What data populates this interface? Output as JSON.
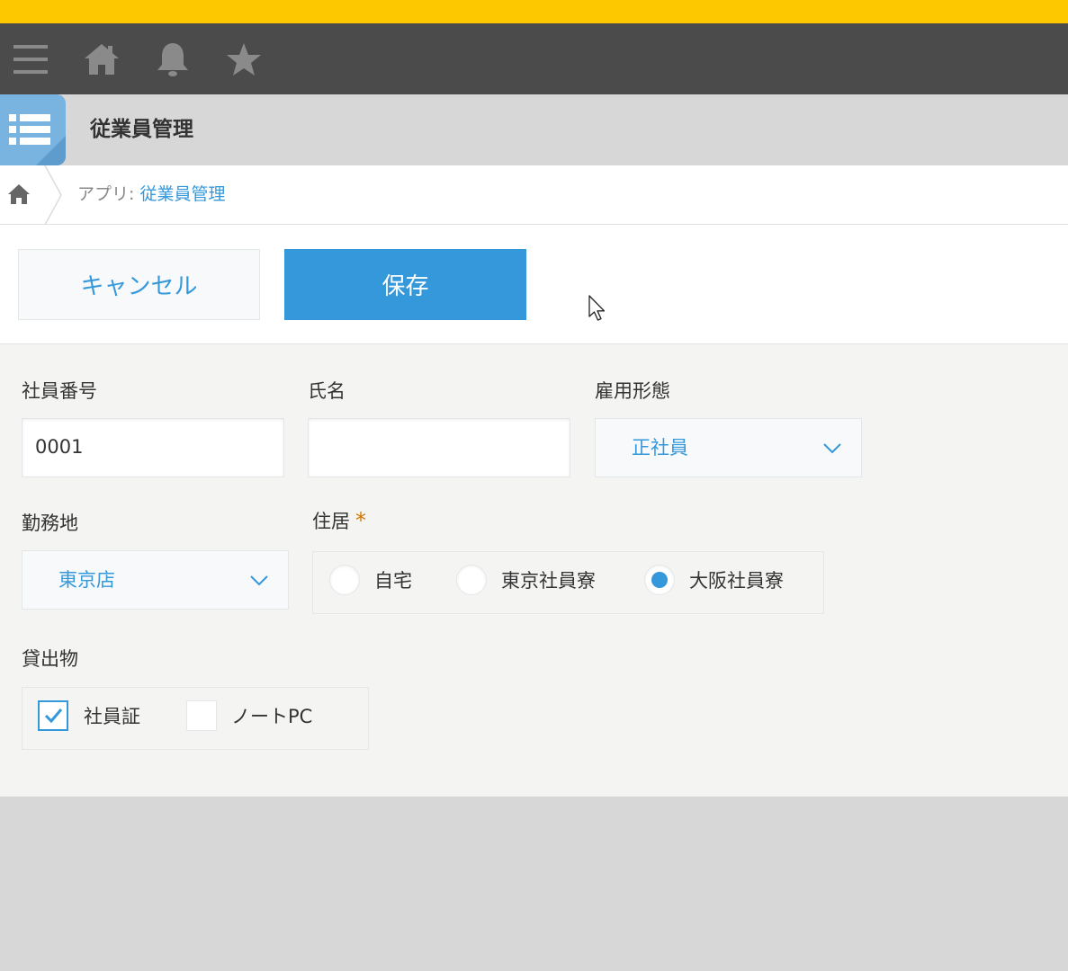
{
  "app": {
    "title": "従業員管理",
    "accent_color": "#3498db",
    "stripe_color": "#fdc800"
  },
  "nav": {
    "icons": [
      "menu-icon",
      "home-icon",
      "bell-icon",
      "star-icon"
    ]
  },
  "breadcrumb": {
    "prefix": "アプリ: ",
    "link": "従業員管理"
  },
  "toolbar": {
    "cancel_label": "キャンセル",
    "save_label": "保存"
  },
  "form": {
    "employee_no": {
      "label": "社員番号",
      "value": "0001"
    },
    "name": {
      "label": "氏名",
      "value": ""
    },
    "employment_type": {
      "label": "雇用形態",
      "value": "正社員"
    },
    "work_location": {
      "label": "勤務地",
      "value": "東京店"
    },
    "residence": {
      "label": "住居",
      "required_mark": "*",
      "options": [
        "自宅",
        "東京社員寮",
        "大阪社員寮"
      ],
      "selected": "大阪社員寮"
    },
    "loan_items": {
      "label": "貸出物",
      "options": [
        "社員証",
        "ノートPC"
      ],
      "checked": [
        "社員証"
      ]
    }
  }
}
